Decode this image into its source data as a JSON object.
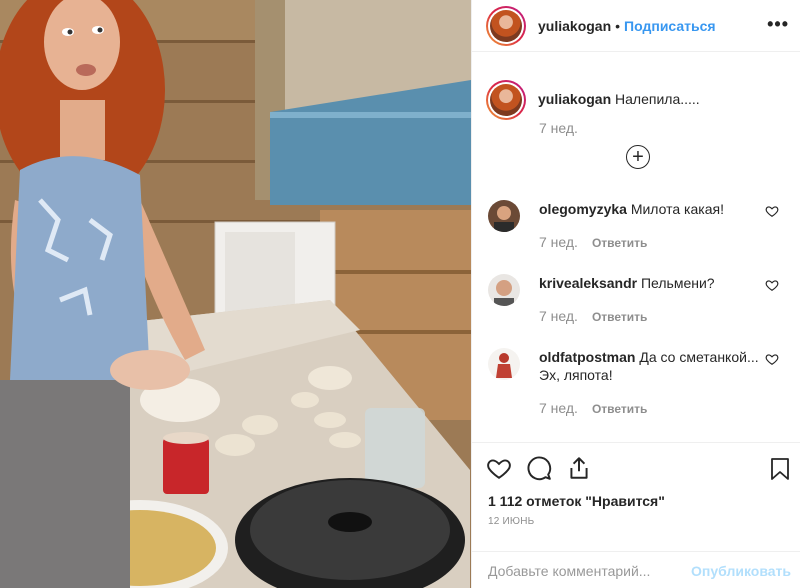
{
  "header": {
    "username": "yuliakogan",
    "dot": "•",
    "follow_label": "Подписаться",
    "more_label": "•••"
  },
  "caption": {
    "username": "yuliakogan",
    "text": "Налепила.....",
    "time": "7 нед."
  },
  "add_replies_label": "+",
  "comments": [
    {
      "username": "olegomyzyka",
      "text": "Милота какая!⁣",
      "time": "7 нед.",
      "reply_label": "Ответить"
    },
    {
      "username": "krivealeksandr",
      "text": "Пельмени?",
      "time": "7 нед.",
      "reply_label": "Ответить"
    },
    {
      "username": "oldfatpostman",
      "text": "Да со сметанкой... Эх, ляпота!",
      "time": "7 нед.",
      "reply_label": "Ответить"
    }
  ],
  "likes_text": "1 112 отметок \"Нравится\"",
  "date": "12 ИЮНЬ",
  "comment_input": {
    "placeholder": "Добавьте комментарий...",
    "value": ""
  },
  "publish_label": "Опубликовать",
  "icons": [
    "heart-icon",
    "comment-icon",
    "share-icon",
    "bookmark-icon",
    "more-icon",
    "plus-circle-icon"
  ],
  "colors": {
    "link": "#3897f0",
    "secondary": "#8e8e8e",
    "publish_disabled": "#b2dffc",
    "text": "#262626"
  }
}
